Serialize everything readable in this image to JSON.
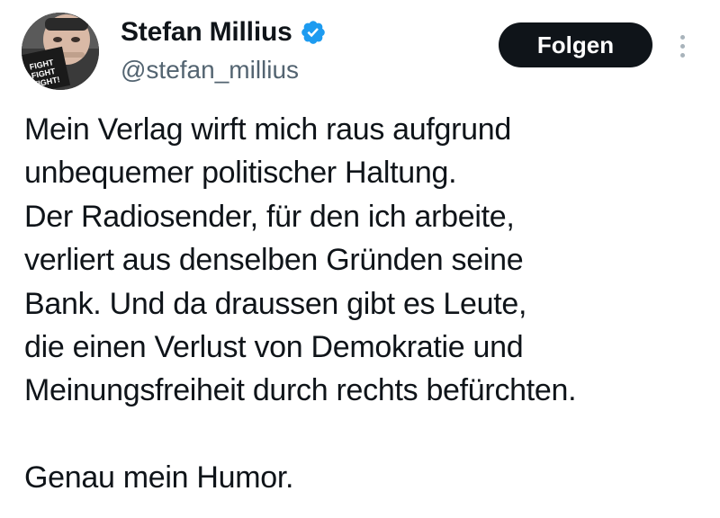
{
  "author": {
    "display_name": "Stefan Millius",
    "handle": "@stefan_millius",
    "verified": true,
    "verified_color": "#1d9bf0"
  },
  "actions": {
    "follow_label": "Folgen",
    "more_icon": "more-vertical-icon"
  },
  "tweet": {
    "lines": [
      "Mein Verlag wirft mich raus aufgrund",
      "unbequemer politischer Haltung.",
      "Der Radiosender, für den ich arbeite,",
      "verliert aus denselben Gründen seine",
      "Bank. Und da draussen gibt es Leute,",
      "die einen Verlust von Demokratie und",
      "Meinungsfreiheit durch rechts befürchten."
    ],
    "closing": "Genau mein Humor."
  },
  "avatar": {
    "mug_text": [
      "FIGHT",
      "FIGHT",
      "FIGHT!"
    ]
  }
}
